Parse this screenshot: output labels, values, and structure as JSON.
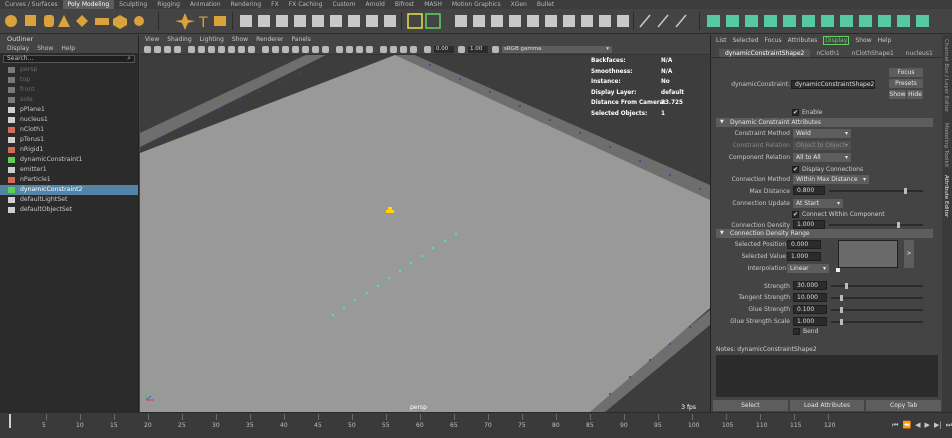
{
  "shelf_tabs": [
    "Curves / Surfaces",
    "Poly Modeling",
    "Sculpting",
    "Rigging",
    "Animation",
    "Rendering",
    "FX",
    "FX Caching",
    "Custom",
    "Arnold",
    "Bifrost",
    "MASH",
    "Motion Graphics",
    "XGen",
    "Bullet"
  ],
  "active_shelf_tab": "Poly Modeling",
  "outliner": {
    "title": "Outliner",
    "menu": [
      "Display",
      "Show",
      "Help"
    ],
    "search_placeholder": "Search...",
    "items": [
      {
        "label": "persp",
        "dim": true,
        "color": "#7a7a7a"
      },
      {
        "label": "top",
        "dim": true,
        "color": "#7a7a7a"
      },
      {
        "label": "front",
        "dim": true,
        "color": "#7a7a7a"
      },
      {
        "label": "side",
        "dim": true,
        "color": "#7a7a7a"
      },
      {
        "label": "pPlane1",
        "dim": false,
        "color": "#cfcfcf"
      },
      {
        "label": "nucleus1",
        "dim": false,
        "color": "#cfcfcf"
      },
      {
        "label": "nCloth1",
        "dim": false,
        "color": "#d46a5a"
      },
      {
        "label": "pTorus1",
        "dim": false,
        "color": "#cfcfcf"
      },
      {
        "label": "nRigid1",
        "dim": false,
        "color": "#d46a5a"
      },
      {
        "label": "dynamicConstraint1",
        "dim": false,
        "color": "#5fcf4f"
      },
      {
        "label": "emitter1",
        "dim": false,
        "color": "#cfcfcf"
      },
      {
        "label": "nParticle1",
        "dim": false,
        "color": "#d46a5a"
      },
      {
        "label": "dynamicConstraint2",
        "dim": false,
        "selected": true,
        "color": "#5fcf4f"
      },
      {
        "label": "defaultLightSet",
        "dim": false,
        "color": "#cfcfcf"
      },
      {
        "label": "defaultObjectSet",
        "dim": false,
        "color": "#cfcfcf"
      }
    ]
  },
  "viewport": {
    "menu": [
      "View",
      "Shading",
      "Lighting",
      "Show",
      "Renderer",
      "Panels"
    ],
    "field_a": "0.00",
    "field_b": "1.00",
    "color_space": "sRGB gamma",
    "hud": [
      {
        "label": "Backfaces:",
        "value": "N/A"
      },
      {
        "label": "Smoothness:",
        "value": "N/A"
      },
      {
        "label": "Instance:",
        "value": "No"
      },
      {
        "label": "Display Layer:",
        "value": "default"
      },
      {
        "label": "Distance From Camera:",
        "value": "33.725"
      },
      {
        "label": "Selected Objects:",
        "value": "1"
      }
    ],
    "camera": "persp",
    "fps": "3 fps"
  },
  "attribute_editor": {
    "menu": [
      "List",
      "Selected",
      "Focus",
      "Attributes",
      "Display",
      "Show",
      "Help"
    ],
    "highlighted_menu": "Display",
    "tabs": [
      "dynamicConstraintShape2",
      "nCloth1",
      "nClothShape1",
      "nucleus1"
    ],
    "node_label": "dynamicConstraint:",
    "node_value": "dynamicConstraintShape2",
    "focus_btn": "Focus",
    "presets_btn": "Presets",
    "show_btn": "Show",
    "hide_btn": "Hide",
    "enable_label": "Enable",
    "section_attrs": "Dynamic Constraint Attributes",
    "constraint_method_label": "Constraint Method",
    "constraint_method_value": "Weld",
    "constraint_relation_label": "Constraint Relation",
    "constraint_relation_value": "Object to Object",
    "component_relation_label": "Component Relation",
    "component_relation_value": "All to All",
    "display_connections_label": "Display Connections",
    "connection_method_label": "Connection Method",
    "connection_method_value": "Within Max Distance",
    "max_distance_label": "Max Distance",
    "max_distance_value": "0.800",
    "connection_update_label": "Connection Update",
    "connection_update_value": "At Start",
    "connect_within_label": "Connect Within Component",
    "connection_density_label": "Connection Density",
    "connection_density_value": "1.000",
    "section_density": "Connection Density Range",
    "selected_position_label": "Selected Position",
    "selected_position_value": "0.000",
    "selected_value_label": "Selected Value",
    "selected_value_value": "1.000",
    "interpolation_label": "Interpolation",
    "interpolation_value": "Linear",
    "ramp_arrow": ">",
    "strength_label": "Strength",
    "strength_value": "30.000",
    "tangent_strength_label": "Tangent Strength",
    "tangent_strength_value": "10.000",
    "glue_strength_label": "Glue Strength",
    "glue_strength_value": "0.100",
    "glue_strength_scale_label": "Glue Strength Scale",
    "glue_strength_scale_value": "1.000",
    "bend_label": "Bend",
    "notes_label": "Notes:",
    "notes_value": "dynamicConstraintShape2",
    "bottom_buttons": [
      "Select",
      "Load Attributes",
      "Copy Tab"
    ]
  },
  "side_strip": [
    "Channel Box / Layer Editor",
    "Modeling Toolkit",
    "Attribute Editor"
  ],
  "timeline": {
    "labels": [
      "5",
      "10",
      "15",
      "20",
      "25",
      "30",
      "35",
      "40",
      "45",
      "50",
      "55",
      "60",
      "65",
      "70",
      "75",
      "80",
      "85",
      "90",
      "95",
      "100",
      "105",
      "110",
      "115",
      "120"
    ],
    "current_frame": "1"
  },
  "colors": {
    "accent": "#5285a6",
    "constraint_dots": "#4fe0a0",
    "hud_text": "#ffffff"
  }
}
